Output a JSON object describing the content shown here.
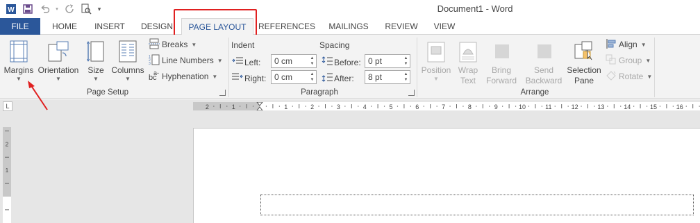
{
  "window": {
    "title": "Document1 - Word"
  },
  "qat": {
    "icons": [
      "word-app-icon",
      "save-icon",
      "undo-icon",
      "redo-icon",
      "print-preview-icon",
      "customize-qat-icon"
    ]
  },
  "tabs": [
    "FILE",
    "HOME",
    "INSERT",
    "DESIGN",
    "PAGE LAYOUT",
    "REFERENCES",
    "MAILINGS",
    "REVIEW",
    "VIEW"
  ],
  "active_tab": "PAGE LAYOUT",
  "colors": {
    "file_tab": "#2b579a",
    "accent": "#2b579a",
    "highlight": "#e02020",
    "ribbon_bg": "#f3f3f3"
  },
  "page_setup": {
    "label": "Page Setup",
    "margins": "Margins",
    "orientation": "Orientation",
    "size": "Size",
    "columns": "Columns",
    "breaks": "Breaks",
    "line_numbers": "Line Numbers",
    "hyphenation": "Hyphenation"
  },
  "paragraph": {
    "label": "Paragraph",
    "indent": "Indent",
    "spacing": "Spacing",
    "left_label": "Left:",
    "left_value": "0 cm",
    "right_label": "Right:",
    "right_value": "0 cm",
    "before_label": "Before:",
    "before_value": "0 pt",
    "after_label": "After:",
    "after_value": "8 pt"
  },
  "arrange": {
    "label": "Arrange",
    "position": "Position",
    "wrap_text_1": "Wrap",
    "wrap_text_2": "Text",
    "bring_forward_1": "Bring",
    "bring_forward_2": "Forward",
    "send_backward_1": "Send",
    "send_backward_2": "Backward",
    "selection_pane_1": "Selection",
    "selection_pane_2": "Pane",
    "align": "Align",
    "group": "Group",
    "rotate": "Rotate"
  },
  "ruler": {
    "tab_selector": "L",
    "h_numbers": [
      "2",
      "1",
      "1",
      "2",
      "3",
      "4",
      "5",
      "6",
      "7",
      "8",
      "9",
      "10",
      "11",
      "12",
      "13",
      "14",
      "15",
      "16"
    ],
    "v_numbers": [
      "2",
      "1",
      "1"
    ]
  }
}
